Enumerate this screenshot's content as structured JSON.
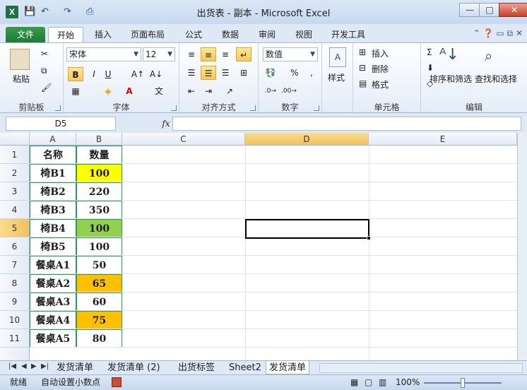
{
  "window": {
    "title": "出货表 - 副本 - Microsoft Excel",
    "app_icon_letter": "X",
    "minimize": "—",
    "maximize": "□",
    "close": "✕"
  },
  "tabs": [
    "文件",
    "开始",
    "插入",
    "页面布局",
    "公式",
    "数据",
    "审阅",
    "视图",
    "开发工具"
  ],
  "ribbon": {
    "clipboard": {
      "paste_label": "粘贴",
      "group_label": "剪贴板"
    },
    "font": {
      "font_name": "宋体",
      "font_size": "12",
      "bold": "B",
      "italic": "I",
      "underline": "U",
      "group_label": "字体"
    },
    "alignment": {
      "group_label": "对齐方式"
    },
    "number": {
      "format": "数值",
      "percent": "%",
      "comma": ",",
      "group_label": "数字"
    },
    "styles": {
      "label": "样式"
    },
    "cells": {
      "insert": "插入",
      "delete": "删除",
      "format": "格式",
      "group_label": "单元格"
    },
    "editing": {
      "sort_filter": "排序和筛选",
      "find_select": "查找和选择",
      "group_label": "编辑"
    }
  },
  "formula_bar": {
    "name_box": "D5",
    "fx": "fx",
    "value": ""
  },
  "columns": [
    "A",
    "B",
    "C",
    "D",
    "E"
  ],
  "active_column": "D",
  "active_row": "5",
  "rows": [
    {
      "num": "1",
      "a": "名称",
      "b": "数量",
      "b_color": "#ffffff"
    },
    {
      "num": "2",
      "a": "椅B1",
      "b": "100",
      "b_color": "#ffff00"
    },
    {
      "num": "3",
      "a": "椅B2",
      "b": "220",
      "b_color": "#ffffff"
    },
    {
      "num": "4",
      "a": "椅B3",
      "b": "350",
      "b_color": "#ffffff"
    },
    {
      "num": "5",
      "a": "椅B4",
      "b": "100",
      "b_color": "#92d050"
    },
    {
      "num": "6",
      "a": "椅B5",
      "b": "100",
      "b_color": "#ffffff"
    },
    {
      "num": "7",
      "a": "餐桌A1",
      "b": "50",
      "b_color": "#ffffff"
    },
    {
      "num": "8",
      "a": "餐桌A2",
      "b": "65",
      "b_color": "#ffc000"
    },
    {
      "num": "9",
      "a": "餐桌A3",
      "b": "60",
      "b_color": "#ffffff"
    },
    {
      "num": "10",
      "a": "餐桌A4",
      "b": "75",
      "b_color": "#ffc000"
    },
    {
      "num": "11",
      "a": "餐桌A5",
      "b": "80",
      "b_color": "#ffffff"
    }
  ],
  "sheet_tabs": [
    "发货清单",
    "发货清单 (2)",
    "出货标签",
    "Sheet2",
    "发货清单"
  ],
  "active_sheet_index": 4,
  "status": {
    "mode": "就绪",
    "auto_decimal": "自动设置小数点",
    "zoom": "100%"
  }
}
